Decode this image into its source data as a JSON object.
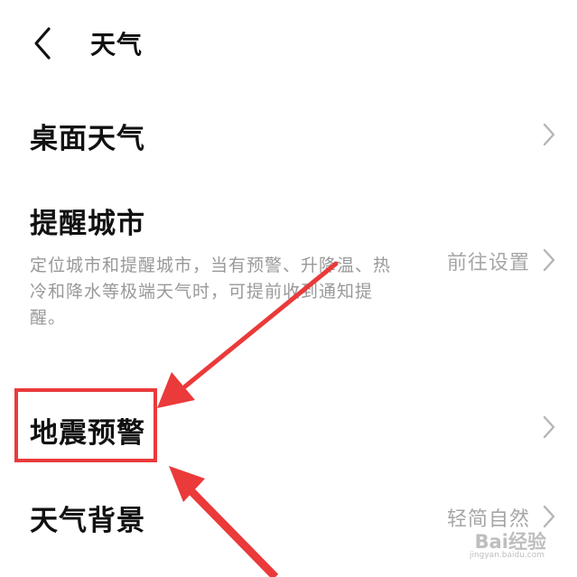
{
  "header": {
    "back_icon": "chevron-left-icon",
    "title": "天气"
  },
  "settings": {
    "desktop_weather": {
      "label": "桌面天气"
    },
    "reminder_city": {
      "label": "提醒城市",
      "description": "定位城市和提醒城市，当有预警、升降温、热冷和降水等极端天气时，可提前收到通知提醒。",
      "value": "前往设置"
    },
    "earthquake_warning": {
      "label": "地震预警"
    },
    "weather_background": {
      "label": "天气背景",
      "value": "轻简自然"
    }
  },
  "annotation": {
    "highlight_color": "#ea3a3a",
    "arrow_color": "#ea3a3a"
  },
  "watermark": {
    "text": "Bai经验",
    "subtext": "jingyan.baidu.com"
  }
}
